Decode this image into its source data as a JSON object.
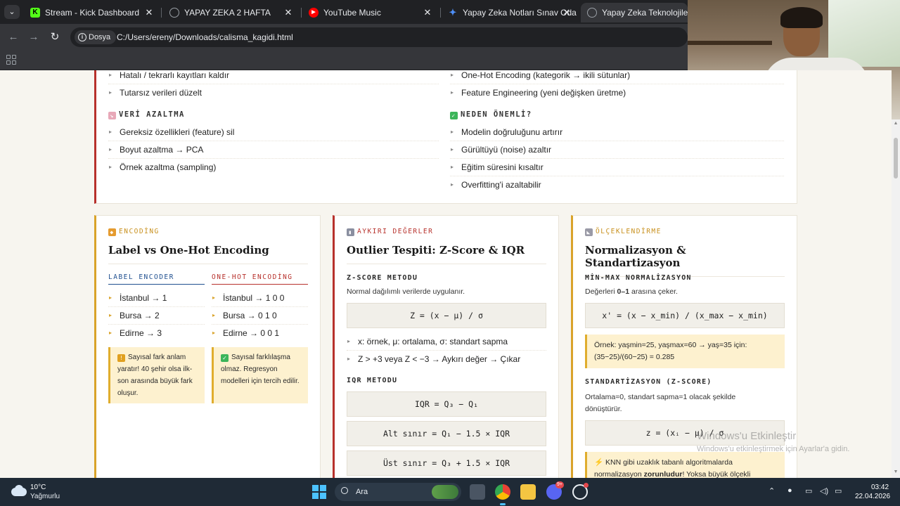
{
  "browser": {
    "tabs": [
      {
        "label": "Stream - Kick Dashboard",
        "favicon": "K",
        "favicon_color": "#53fc18"
      },
      {
        "label": "YAPAY ZEKA 2 HAFTA",
        "favicon": "globe",
        "favicon_color": "#9aa0a6"
      },
      {
        "label": "YouTube Music",
        "favicon": "▶",
        "favicon_color": "#ff0000"
      },
      {
        "label": "Yapay Zeka Notları Sınav Odakl",
        "favicon": "✦",
        "favicon_color": "#4e8ff7"
      },
      {
        "label": "Yapay Zeka Teknolojileri – Sı",
        "favicon": "globe",
        "favicon_color": "#9aa0a6"
      }
    ],
    "site_chip": "Dosya",
    "url": "C:/Users/ereny/Downloads/calisma_kagidi.html"
  },
  "top_card": {
    "left_top_items": [
      "Hatalı / tekrarlı kayıtları kaldır",
      "Tutarsız verileri düzelt"
    ],
    "right_top_items": [
      "One-Hot Encoding (kategorik → ikili sütunlar)",
      "Feature Engineering (yeni değişken üretme)"
    ],
    "left_heading": "VERİ AZALTMA",
    "left_items": [
      "Gereksiz özellikleri (feature) sil",
      "Boyut azaltma → PCA",
      "Örnek azaltma (sampling)"
    ],
    "right_heading": "NEDEN ÖNEMLİ?",
    "right_items": [
      "Modelin doğruluğunu artırır",
      "Gürültüyü (noise) azaltır",
      "Eğitim süresini kısaltır",
      "Overfitting'i azaltabilir"
    ]
  },
  "encoding_card": {
    "eyebrow": "ENCODİNG",
    "title": "Label vs One-Hot Encoding",
    "label_heading": "LABEL ENCODER",
    "label_items": [
      "İstanbul → 1",
      "Bursa → 2",
      "Edirne → 3"
    ],
    "label_note": "Sayısal fark anlam yaratır! 40 şehir olsa ilk-son arasında büyük fark oluşur.",
    "onehot_heading": "ONE-HOT ENCODİNG",
    "onehot_items": [
      "İstanbul → 1 0 0",
      "Bursa → 0 1 0",
      "Edirne → 0 0 1"
    ],
    "onehot_note": "Sayısal farklılaşma olmaz. Regresyon modelleri için tercih edilir."
  },
  "outlier_card": {
    "eyebrow": "AYKIRI DEĞERLER",
    "title": "Outlier Tespiti: Z-Score & IQR",
    "zscore_heading": "Z-SCORE METODU",
    "zscore_desc": "Normal dağılımlı verilerde uygulanır.",
    "zscore_formula": "Z = (x − μ) / σ",
    "zscore_items": [
      "x: örnek, μ: ortalama, σ: standart sapma",
      "Z > +3 veya Z < −3 → Aykırı değer → Çıkar"
    ],
    "iqr_heading": "IQR METODU",
    "iqr_formulas": [
      "IQR = Q₃ − Q₁",
      "Alt sınır = Q₁ − 1.5 × IQR",
      "Üst sınır = Q₃ + 1.5 × IQR"
    ]
  },
  "scaling_card": {
    "eyebrow": "ÖLÇEKLENDİRME",
    "title": "Normalizasyon & Standartizasyon",
    "minmax_heading": "MİN-MAX NORMALİZASYON",
    "minmax_desc_pre": "Değerleri ",
    "minmax_desc_bold": "0–1",
    "minmax_desc_post": " arasına çeker.",
    "minmax_formula": "x' = (x − x_min) / (x_max − x_min)",
    "minmax_example": "Örnek: yaşmin=25, yaşmax=60 → yaş=35 için: (35−25)/(60−25) = 0.285",
    "std_heading": "STANDARTİZASYON (Z-SCORE)",
    "std_desc": "Ortalama=0, standart sapma=1 olacak şekilde dönüştürür.",
    "std_formula": "z = (xᵢ − μ) / σ",
    "knn_note_pre": "KNN gibi uzaklık tabanlı algoritmalarda normalizasyon ",
    "knn_note_bold": "zorunludur",
    "knn_note_post": "! Yoksa büyük ölçekli"
  },
  "watermark": {
    "line1": "Windows'u Etkinleştir",
    "line2": "Windows'u etkinleştirmek için Ayarlar'a gidin."
  },
  "taskbar": {
    "temperature": "10°C",
    "weather": "Yağmurlu",
    "search_placeholder": "Ara",
    "discord_badge": "9+",
    "time": "03:42",
    "date": "22.04.2026"
  }
}
